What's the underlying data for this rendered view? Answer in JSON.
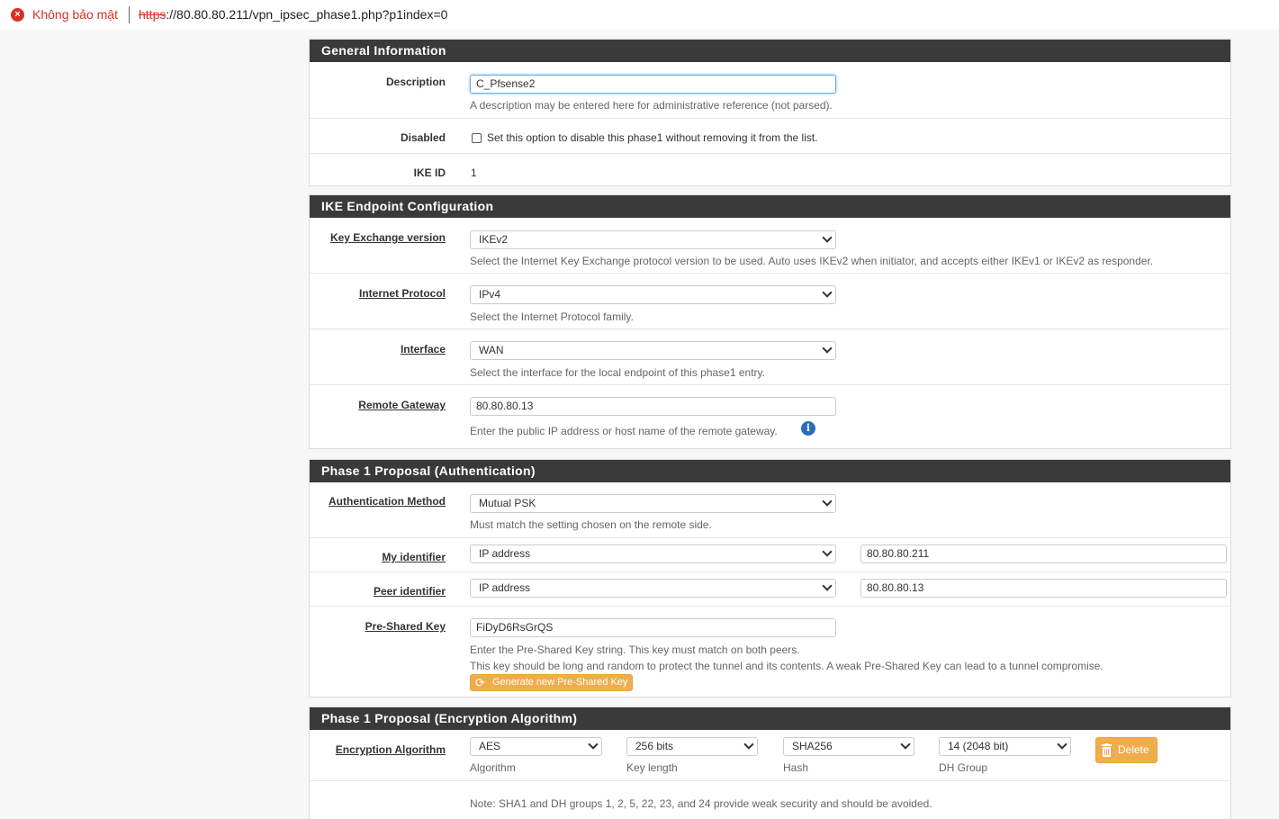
{
  "browser": {
    "security_label": "Không bảo mật",
    "url_scheme": "https",
    "url_rest": "://80.80.80.211/vpn_ipsec_phase1.php?p1index=0"
  },
  "general": {
    "heading": "General Information",
    "description_label": "Description",
    "description_value": "C_Pfsense2",
    "description_help": "A description may be entered here for administrative reference (not parsed).",
    "disabled_label": "Disabled",
    "disabled_help": "Set this option to disable this phase1 without removing it from the list.",
    "ikeid_label": "IKE ID",
    "ikeid_value": "1"
  },
  "endpoint": {
    "heading": "IKE Endpoint Configuration",
    "kex_label": "Key Exchange version",
    "kex_value": "IKEv2",
    "kex_help": "Select the Internet Key Exchange protocol version to be used. Auto uses IKEv2 when initiator, and accepts either IKEv1 or IKEv2 as responder.",
    "proto_label": "Internet Protocol",
    "proto_value": "IPv4",
    "proto_help": "Select the Internet Protocol family.",
    "iface_label": "Interface",
    "iface_value": "WAN",
    "iface_help": "Select the interface for the local endpoint of this phase1 entry.",
    "gw_label": "Remote Gateway",
    "gw_value": "80.80.80.13",
    "gw_help": "Enter the public IP address or host name of the remote gateway."
  },
  "auth": {
    "heading": "Phase 1 Proposal (Authentication)",
    "method_label": "Authentication Method",
    "method_value": "Mutual PSK",
    "method_help": "Must match the setting chosen on the remote side.",
    "myid_label": "My identifier",
    "myid_type": "IP address",
    "myid_value": "80.80.80.211",
    "peerid_label": "Peer identifier",
    "peerid_type": "IP address",
    "peerid_value": "80.80.80.13",
    "psk_label": "Pre-Shared Key",
    "psk_value": "FiDyD6RsGrQS",
    "psk_help1": "Enter the Pre-Shared Key string. This key must match on both peers.",
    "psk_help2": "This key should be long and random to protect the tunnel and its contents. A weak Pre-Shared Key can lead to a tunnel compromise.",
    "psk_button": "Generate new Pre-Shared Key"
  },
  "enc": {
    "heading": "Phase 1 Proposal (Encryption Algorithm)",
    "alg_label": "Encryption Algorithm",
    "algorithm": "AES",
    "algorithm_caption": "Algorithm",
    "keylen": "256 bits",
    "keylen_caption": "Key length",
    "hash": "SHA256",
    "hash_caption": "Hash",
    "dh": "14 (2048 bit)",
    "dh_caption": "DH Group",
    "delete_label": "Delete",
    "note": "Note: SHA1 and DH groups 1, 2, 5, 22, 23, and 24 provide weak security and should be avoided."
  }
}
